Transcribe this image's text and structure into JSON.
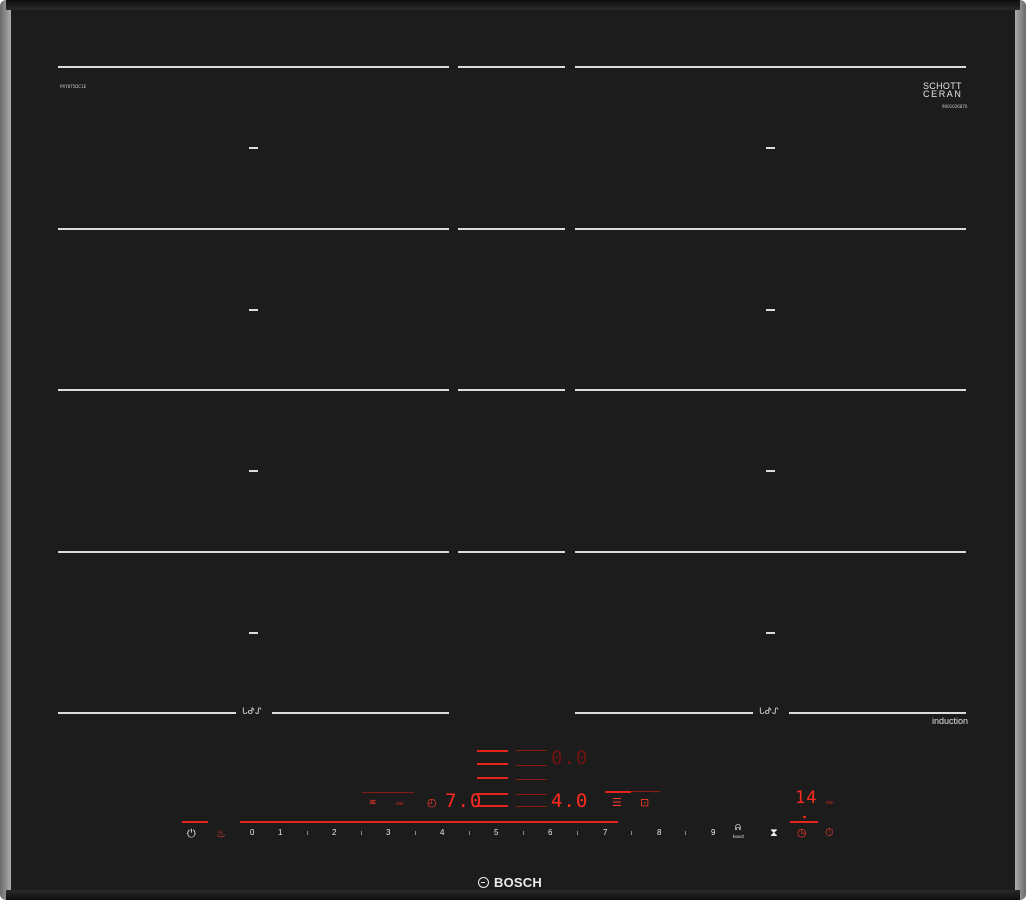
{
  "hob": {
    "model_code": "PXY875DC1E",
    "serial_code": "9001026870",
    "glass_brand": "SCHOTT CERAN",
    "glass_brand_line1": "SCHOTT",
    "glass_brand_line2": "CERAN",
    "technology_label": "induction",
    "brand": "BOSCH",
    "zone_marker": "–",
    "flex_zone_symbol": "ᒐᕷᔑ"
  },
  "displays": {
    "top_right_zone": "0.0",
    "left_power": "7.0",
    "right_power": "4.0",
    "timer": "14",
    "timer_unit": "min"
  },
  "slider": {
    "levels": [
      "0",
      "1",
      "2",
      "3",
      "4",
      "5",
      "6",
      "7",
      "8",
      "9"
    ],
    "boost_label": "boost",
    "boost_symbol": "ᕱ"
  },
  "controls": {
    "power_icon": "power-icon",
    "child_lock_icon": "child-lock-icon",
    "timer_icon": "timer-icon",
    "move_function_icon": "move-function-icon",
    "power_management_icon": "power-management-icon",
    "stopwatch_icon": "stopwatch-icon",
    "alarm_clock_icon": "alarm-clock-icon",
    "power_symbol": "⏻",
    "child_lock_symbol": "♨",
    "timer_symbol": "◴",
    "move_symbol": "⧗",
    "stopwatch_symbol": "◷",
    "alarm_symbol": "⏱",
    "menu_symbol": "☰",
    "camera_symbol": "⊡",
    "steam_symbol": "≋"
  },
  "colors": {
    "glass": "#1c1c1c",
    "frame": "#b4b4b4",
    "print_white": "#dcdcdc",
    "display_red": "#ff2a1f"
  }
}
